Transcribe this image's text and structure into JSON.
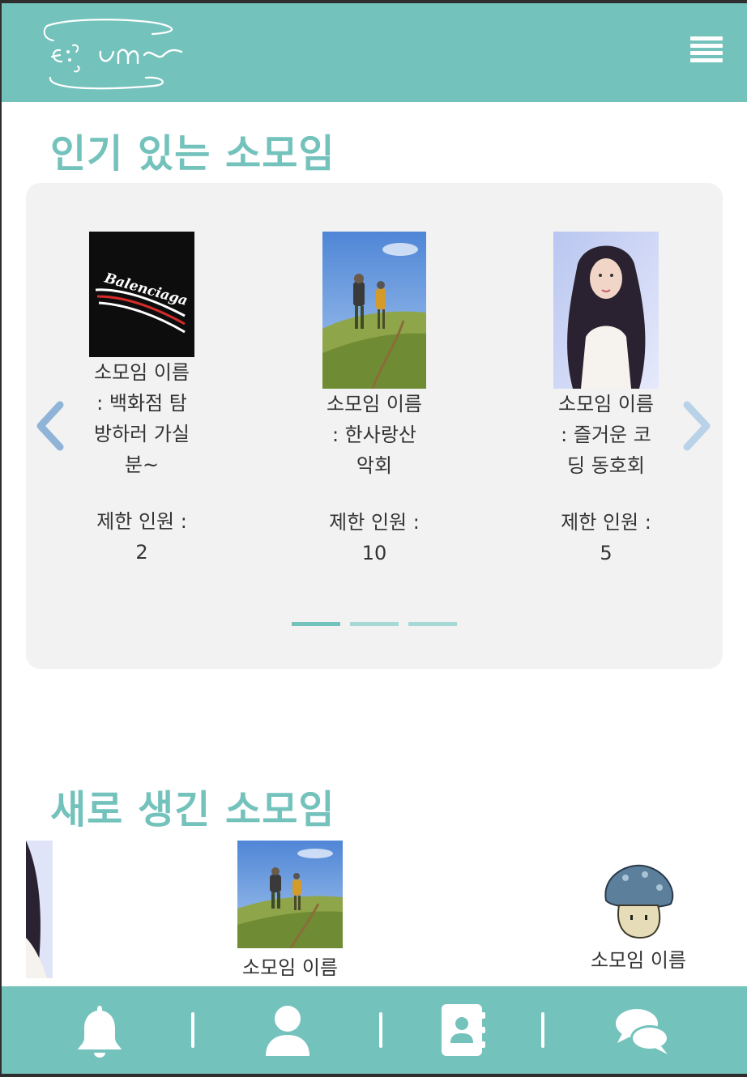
{
  "header": {
    "logo_text": "ɛ.:vm~",
    "menu_icon": "hamburger-menu-icon"
  },
  "popular": {
    "title": "인기 있는 소모임",
    "cards": [
      {
        "name_lines": [
          "소모임 이름",
          ": 백화점 탐",
          "방하러 가실",
          "분~"
        ],
        "limit_label": "제한 인원 :",
        "limit_value": "2",
        "image_text": "Balenciaga"
      },
      {
        "name_lines": [
          "소모임 이름",
          ": 한사랑산",
          "악회"
        ],
        "limit_label": "제한 인원 :",
        "limit_value": "10"
      },
      {
        "name_lines": [
          "소모임 이름",
          ": 즐거운 코",
          "딩 동호회"
        ],
        "limit_label": "제한 인원 :",
        "limit_value": "5"
      }
    ],
    "prev_icon": "chevron-left-icon",
    "next_icon": "chevron-right-icon",
    "page_count": 3,
    "active_page": 1
  },
  "new": {
    "title": "새로 생긴 소모임",
    "cards": [
      {
        "name": "소모임 이름"
      },
      {
        "name": "소모임 이름"
      }
    ]
  },
  "nav": {
    "items": [
      "bell-icon",
      "user-icon",
      "contacts-book-icon",
      "chat-bubbles-icon"
    ]
  },
  "colors": {
    "accent": "#74c2bc",
    "accent_light": "#a6d9d5",
    "carousel_bg": "#f2f2f2",
    "arrow_left": "#8fb4d8",
    "arrow_right": "#b9d2e8"
  }
}
